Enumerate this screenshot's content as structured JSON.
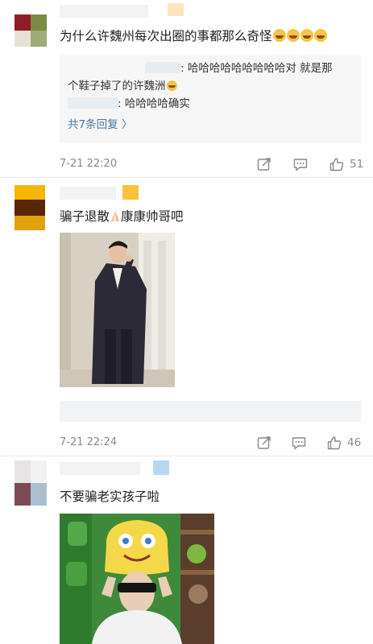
{
  "comments": [
    {
      "text": "为什么许魏州每次出圈的事都那么奇怪",
      "emoji_count": 4,
      "replies": [
        {
          "text_a": ": 哈哈哈哈哈哈哈哈哈对 就是那",
          "text_b": "个鞋子掉了的许魏洲"
        },
        {
          "text": ": 哈哈哈哈确实"
        }
      ],
      "more_replies": "共7条回复 〉",
      "time": "7-21 22:20",
      "likes": "51"
    },
    {
      "text_before": "骗子退散",
      "text_after": "康康帅哥吧",
      "time": "7-21 22:24",
      "likes": "46"
    },
    {
      "text": "不要骗老实孩子啦"
    }
  ],
  "icons": {
    "repost": "repost-icon",
    "comment": "comment-icon",
    "like": "thumbs-up-icon",
    "pray": "praying-hands-icon",
    "laugh": "laughing-emoji-icon"
  },
  "colors": {
    "link": "#4a77a8",
    "reply_bg": "#f6f6f6",
    "meta": "#888888"
  }
}
